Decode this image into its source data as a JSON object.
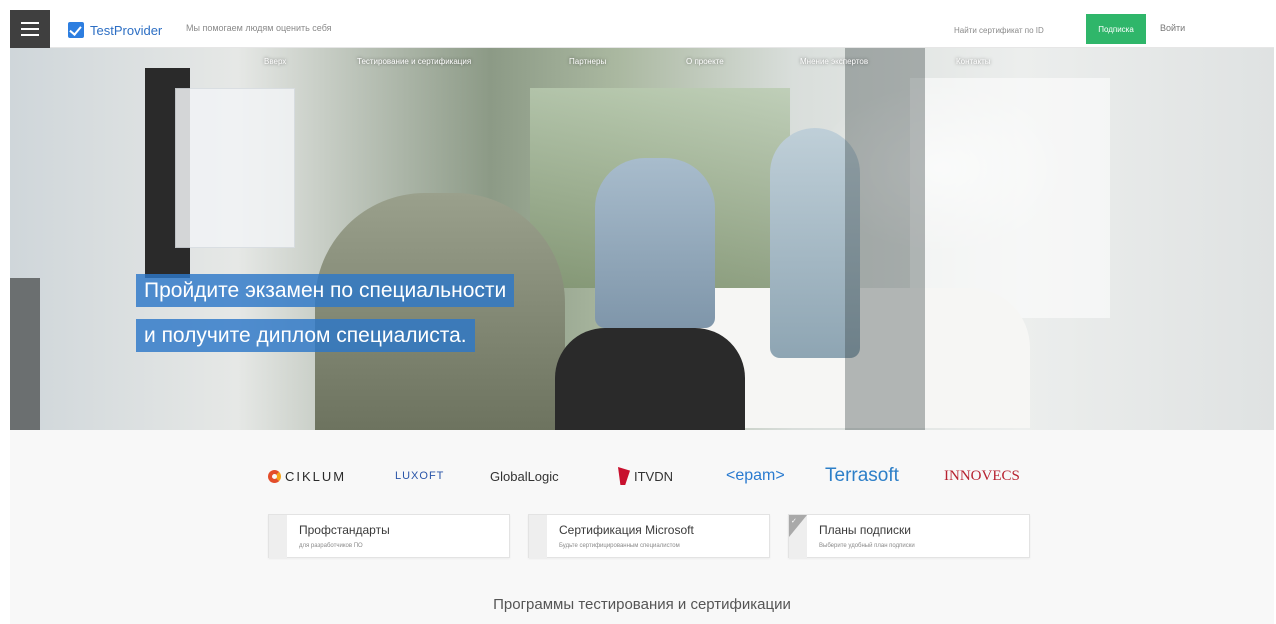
{
  "header": {
    "brand": "TestProvider",
    "tagline": "Мы помогаем людям оценить себя",
    "search_placeholder": "Найти сертификат по ID",
    "subscribe_label": "Подписка",
    "login_label": "Войти",
    "icons": [
      "hamburger-menu-icon",
      "check-logo-icon"
    ]
  },
  "hero": {
    "nav": [
      "Вверх",
      "Тестирование и сертификация",
      "Партнеры",
      "О проекте",
      "Мнение экспертов",
      "Контакты"
    ],
    "headline_line1": "Пройдите экзамен по специальности",
    "headline_line2": "и получите диплом специалиста."
  },
  "partners": [
    "CIKLUM",
    "LUXOFT",
    "GlobalLogic",
    "ITVDN",
    "<epam>",
    "Terrasoft",
    "INNOVECS"
  ],
  "cards": [
    {
      "title": "Профстандарты",
      "subtitle": "для разработчиков ПО"
    },
    {
      "title": "Сертификация Microsoft",
      "subtitle": "Будьте сертифицированным специалистом"
    },
    {
      "title": "Планы подписки",
      "subtitle": "Выберите удобный план подписки"
    }
  ],
  "programs_title": "Программы тестирования и сертификации",
  "colors": {
    "accent_blue": "#2d78c8",
    "subscribe_green": "#2fb66a",
    "menu_dark": "#3f3f3f"
  }
}
